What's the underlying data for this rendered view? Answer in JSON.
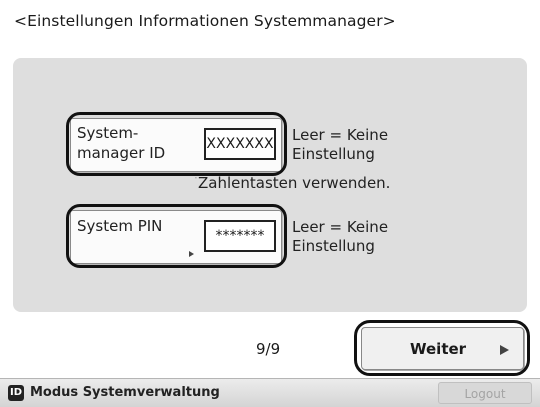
{
  "screen": {
    "title": "<Einstellungen Informationen Systemmanager>"
  },
  "fields": [
    {
      "label_line1": "System-",
      "label_line2": "manager ID",
      "value": "XXXXXXX",
      "hint_line1": "Leer = Keine",
      "hint_line2": "Einstellung"
    },
    {
      "label_line1": "System PIN",
      "label_line2": "",
      "value": "*******",
      "hint_line1": "Leer = Keine",
      "hint_line2": "Einstellung"
    }
  ],
  "note": "Zahlentasten verwenden.",
  "pagination": {
    "counter": "9/9"
  },
  "buttons": {
    "next_label": "Weiter",
    "logout_label": "Logout"
  },
  "status_bar": {
    "mode_icon_letter": "ID",
    "mode_label": "Modus Systemverwaltung"
  }
}
